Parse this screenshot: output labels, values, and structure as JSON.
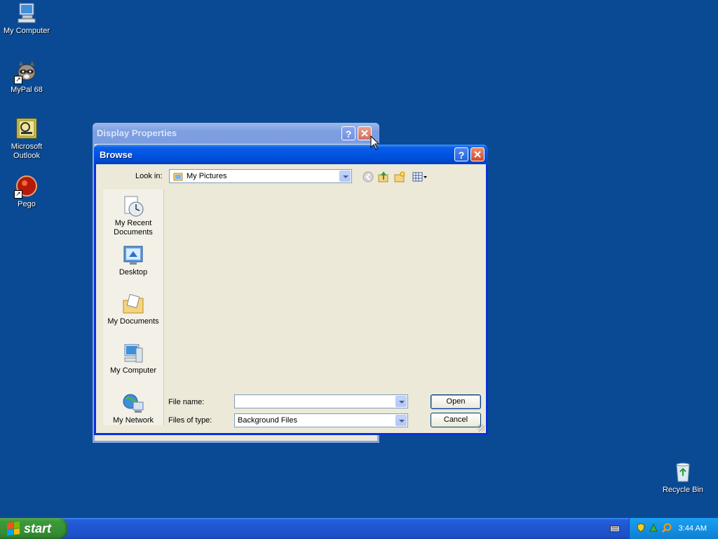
{
  "desktop": {
    "icons": [
      {
        "label": "My Computer"
      },
      {
        "label": "MyPal 68"
      },
      {
        "label": "Microsoft Outlook"
      },
      {
        "label": "Pego"
      },
      {
        "label": "Recycle Bin"
      }
    ]
  },
  "display_properties": {
    "title": "Display Properties",
    "help_label": "?"
  },
  "browse": {
    "title": "Browse",
    "help_label": "?",
    "look_in_label": "Look in:",
    "look_in_value": "My Pictures",
    "places": [
      {
        "label": "My Recent Documents",
        "icon": "recent-documents-icon"
      },
      {
        "label": "Desktop",
        "icon": "desktop-icon"
      },
      {
        "label": "My Documents",
        "icon": "my-documents-icon"
      },
      {
        "label": "My Computer",
        "icon": "my-computer-icon"
      },
      {
        "label": "My Network",
        "icon": "my-network-icon"
      }
    ],
    "file_name_label": "File name:",
    "file_name_value": "",
    "files_of_type_label": "Files of type:",
    "files_of_type_value": "Background Files",
    "open_label": "Open",
    "cancel_label": "Cancel"
  },
  "taskbar": {
    "start_label": "start",
    "clock": "3:44 AM"
  },
  "colors": {
    "desktop": "#0a4a94",
    "title_active": "#0054e3",
    "dialog_face": "#ece9d8"
  }
}
